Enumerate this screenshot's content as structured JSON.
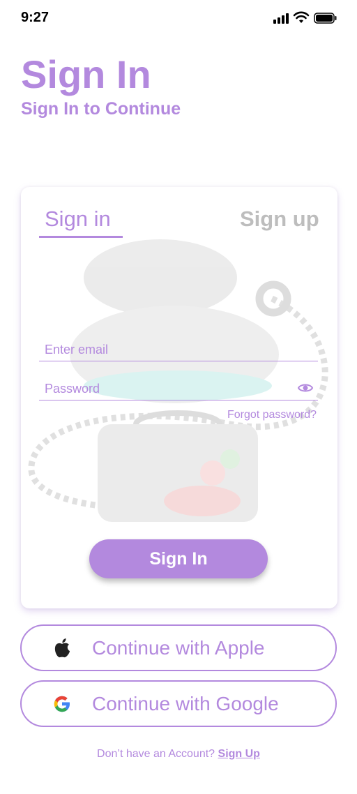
{
  "status_bar": {
    "time": "9:27"
  },
  "header": {
    "title": "Sign In",
    "subtitle": "Sign In to Continue"
  },
  "tabs": {
    "signin": "Sign in",
    "signup": "Sign up"
  },
  "form": {
    "email_placeholder": "Enter email",
    "password_placeholder": "Password",
    "forgot_password": "Forgot password?",
    "submit": "Sign In"
  },
  "social": {
    "apple": "Continue with Apple",
    "google": "Continue with Google"
  },
  "footer": {
    "prompt": "Don’t have an Account?",
    "link": "Sign Up"
  },
  "colors": {
    "accent": "#b389de",
    "inactive_tab": "#bdbdbd"
  },
  "icons": [
    "signal-icon",
    "wifi-icon",
    "battery-icon",
    "eye-icon",
    "apple-icon",
    "google-icon",
    "chef-illustration"
  ]
}
